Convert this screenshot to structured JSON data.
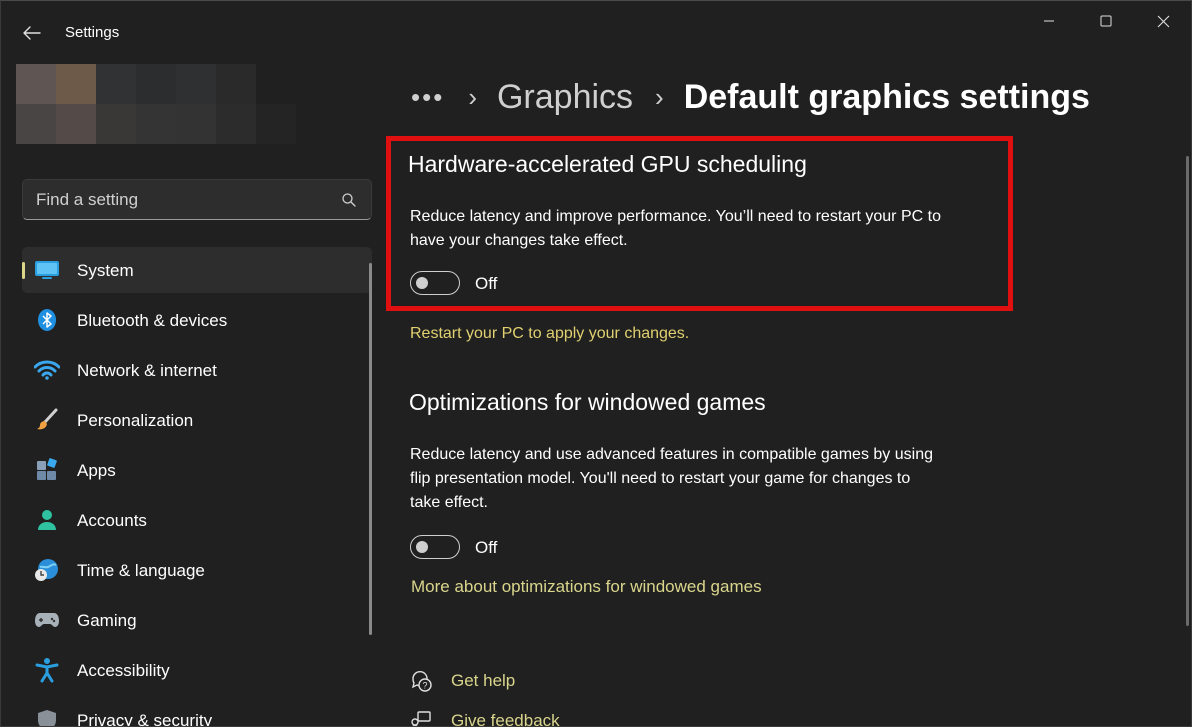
{
  "window": {
    "title": "Settings"
  },
  "search": {
    "placeholder": "Find a setting"
  },
  "sidebar": {
    "items": [
      {
        "label": "System",
        "icon": "monitor-icon"
      },
      {
        "label": "Bluetooth & devices",
        "icon": "bluetooth-icon"
      },
      {
        "label": "Network & internet",
        "icon": "wifi-icon"
      },
      {
        "label": "Personalization",
        "icon": "paintbrush-icon"
      },
      {
        "label": "Apps",
        "icon": "apps-icon"
      },
      {
        "label": "Accounts",
        "icon": "person-icon"
      },
      {
        "label": "Time & language",
        "icon": "globe-clock-icon"
      },
      {
        "label": "Gaming",
        "icon": "gamepad-icon"
      },
      {
        "label": "Accessibility",
        "icon": "accessibility-icon"
      },
      {
        "label": "Privacy & security",
        "icon": "shield-icon"
      }
    ],
    "selected_index": 0
  },
  "breadcrumb": {
    "more": "•••",
    "parent": "Graphics",
    "current": "Default graphics settings"
  },
  "gpu_scheduling": {
    "title": "Hardware-accelerated GPU scheduling",
    "description": "Reduce latency and improve performance. You’ll need to restart your PC to have your changes take effect.",
    "toggle_state": "Off",
    "restart_notice": "Restart your PC to apply your changes."
  },
  "windowed_games": {
    "title": "Optimizations for windowed games",
    "description": "Reduce latency and use advanced features in compatible games by using flip presentation model. You'll need to restart your game for changes to take effect.",
    "toggle_state": "Off",
    "more_link": "More about optimizations for windowed games"
  },
  "help": {
    "get_help": "Get help",
    "give_feedback": "Give feedback"
  },
  "colors": {
    "background": "#202020",
    "accent_yellow": "#d9d58c",
    "highlight_red": "#e01010"
  }
}
